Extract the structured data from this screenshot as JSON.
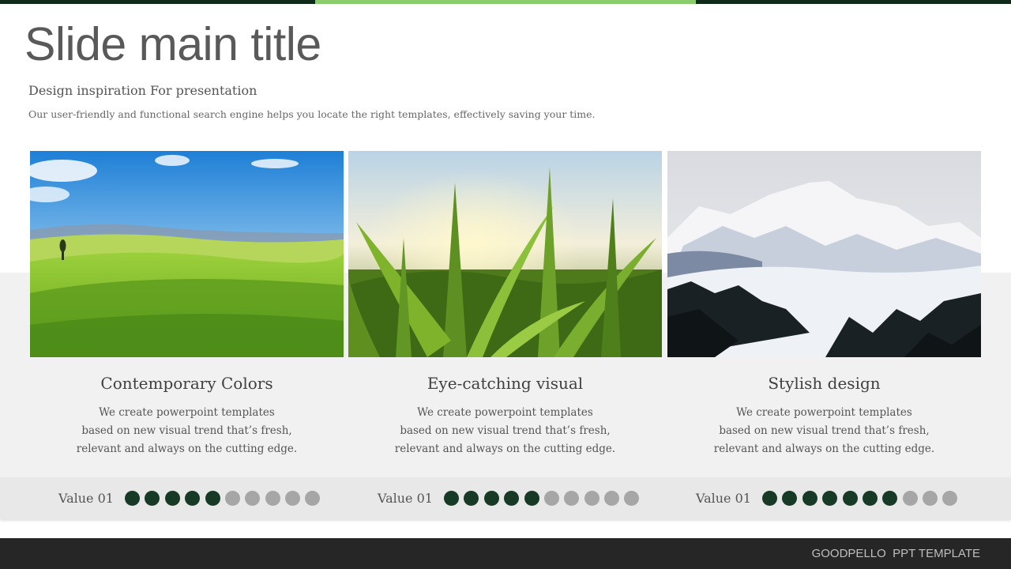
{
  "slide": {
    "title": "Slide main title",
    "subtitle": "Design inspiration For presentation",
    "description": "Our user-friendly and functional search engine helps you locate the right templates, effectively saving your time."
  },
  "colors": {
    "dark_green": "#173a26",
    "accent_green": "#8acb6a",
    "dot_inactive": "#a6a6a6",
    "footer_bg": "#262626"
  },
  "cards": [
    {
      "photo": "rolling-green-hills-photo",
      "title": "Contemporary Colors",
      "body": [
        "We create powerpoint templates",
        "based on new visual trend that’s fresh,",
        "relevant and always on the cutting edge."
      ],
      "rating_label": "Value 01",
      "rating_filled": 5,
      "rating_total": 10
    },
    {
      "photo": "cornfield-photo",
      "title": "Eye-catching visual",
      "body": [
        "We create powerpoint templates",
        "based on new visual trend that’s fresh,",
        "relevant and always on the cutting edge."
      ],
      "rating_label": "Value 01",
      "rating_filled": 5,
      "rating_total": 10
    },
    {
      "photo": "snowy-mountain-photo",
      "title": "Stylish design",
      "body": [
        "We create powerpoint templates",
        "based on new visual trend that’s fresh,",
        "relevant and always on the cutting edge."
      ],
      "rating_label": "Value 01",
      "rating_filled": 7,
      "rating_total": 10
    }
  ],
  "footer": {
    "text": "GOODPELLO  PPT TEMPLATE"
  }
}
